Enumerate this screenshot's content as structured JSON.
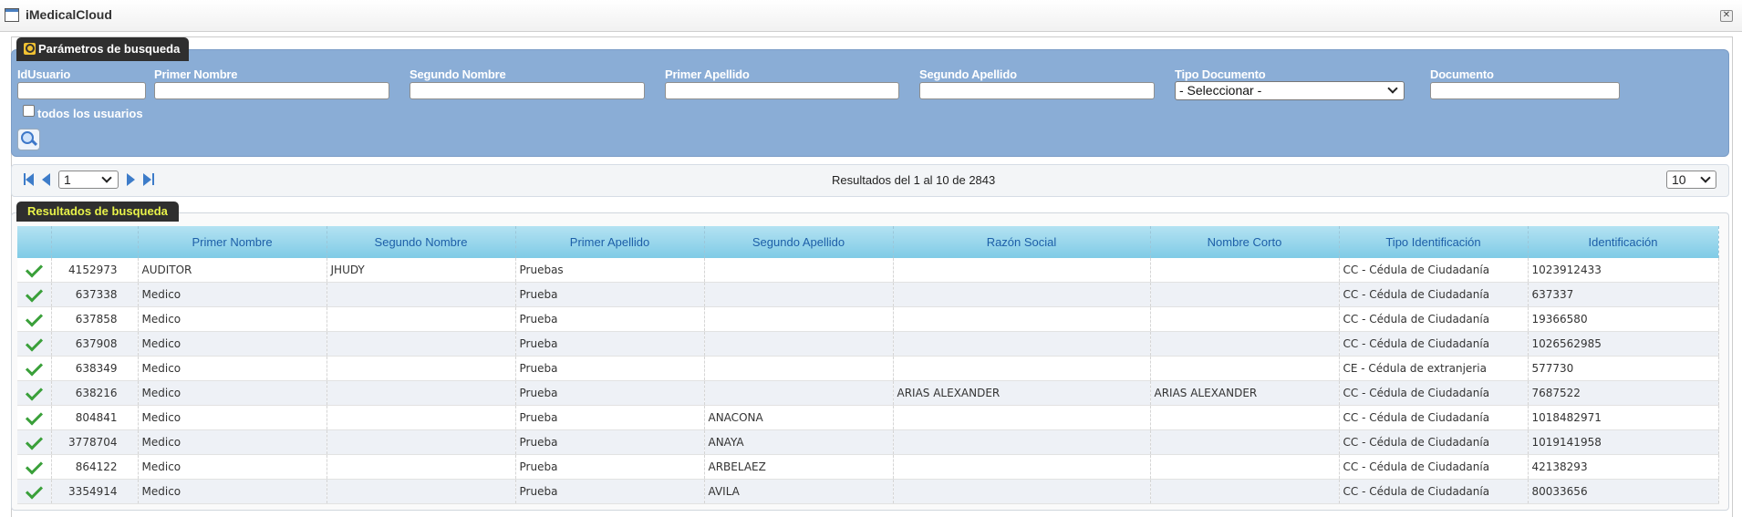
{
  "window": {
    "title": "iMedicalCloud",
    "close_label": "✕"
  },
  "search": {
    "tab_label": "Parámetros de busqueda",
    "fields": {
      "idusuario": {
        "label": "IdUsuario",
        "value": ""
      },
      "primer_nombre": {
        "label": "Primer Nombre",
        "value": ""
      },
      "segundo_nombre": {
        "label": "Segundo Nombre",
        "value": ""
      },
      "primer_apellido": {
        "label": "Primer Apellido",
        "value": ""
      },
      "segundo_apellido": {
        "label": "Segundo Apellido",
        "value": ""
      },
      "tipo_documento": {
        "label": "Tipo Documento",
        "selected": "- Seleccionar -"
      },
      "documento": {
        "label": "Documento",
        "value": ""
      }
    },
    "all_users_label": "todos los usuarios"
  },
  "pager": {
    "page": "1",
    "status": "Resultados del 1 al 10 de 2843",
    "page_size": "10"
  },
  "results": {
    "tab_label": "Resultados de busqueda",
    "columns": [
      "",
      "",
      "Primer Nombre",
      "Segundo Nombre",
      "Primer Apellido",
      "Segundo Apellido",
      "Razón Social",
      "Nombre Corto",
      "Tipo Identificación",
      "Identificación"
    ],
    "rows": [
      {
        "id": "4152973",
        "primer_nombre": "AUDITOR",
        "segundo_nombre": "JHUDY",
        "primer_apellido": "Pruebas",
        "segundo_apellido": "",
        "razon_social": "",
        "nombre_corto": "",
        "tipo_identificacion": "CC - Cédula de Ciudadanía",
        "identificacion": "1023912433"
      },
      {
        "id": "637338",
        "primer_nombre": "Medico",
        "segundo_nombre": "",
        "primer_apellido": "Prueba",
        "segundo_apellido": "",
        "razon_social": "",
        "nombre_corto": "",
        "tipo_identificacion": "CC - Cédula de Ciudadanía",
        "identificacion": "637337"
      },
      {
        "id": "637858",
        "primer_nombre": "Medico",
        "segundo_nombre": "",
        "primer_apellido": "Prueba",
        "segundo_apellido": "",
        "razon_social": "",
        "nombre_corto": "",
        "tipo_identificacion": "CC - Cédula de Ciudadanía",
        "identificacion": "19366580"
      },
      {
        "id": "637908",
        "primer_nombre": "Medico",
        "segundo_nombre": "",
        "primer_apellido": "Prueba",
        "segundo_apellido": "",
        "razon_social": "",
        "nombre_corto": "",
        "tipo_identificacion": "CC - Cédula de Ciudadanía",
        "identificacion": "1026562985"
      },
      {
        "id": "638349",
        "primer_nombre": "Medico",
        "segundo_nombre": "",
        "primer_apellido": "Prueba",
        "segundo_apellido": "",
        "razon_social": "",
        "nombre_corto": "",
        "tipo_identificacion": "CE - Cédula de extranjeria",
        "identificacion": "577730"
      },
      {
        "id": "638216",
        "primer_nombre": "Medico",
        "segundo_nombre": "",
        "primer_apellido": "Prueba",
        "segundo_apellido": "",
        "razon_social": "ARIAS ALEXANDER",
        "nombre_corto": "ARIAS ALEXANDER",
        "tipo_identificacion": "CC - Cédula de Ciudadanía",
        "identificacion": "7687522"
      },
      {
        "id": "804841",
        "primer_nombre": "Medico",
        "segundo_nombre": "",
        "primer_apellido": "Prueba",
        "segundo_apellido": "ANACONA",
        "razon_social": "",
        "nombre_corto": "",
        "tipo_identificacion": "CC - Cédula de Ciudadanía",
        "identificacion": "1018482971"
      },
      {
        "id": "3778704",
        "primer_nombre": "Medico",
        "segundo_nombre": "",
        "primer_apellido": "Prueba",
        "segundo_apellido": "ANAYA",
        "razon_social": "",
        "nombre_corto": "",
        "tipo_identificacion": "CC - Cédula de Ciudadanía",
        "identificacion": "1019141958"
      },
      {
        "id": "864122",
        "primer_nombre": "Medico",
        "segundo_nombre": "",
        "primer_apellido": "Prueba",
        "segundo_apellido": "ARBELAEZ",
        "razon_social": "",
        "nombre_corto": "",
        "tipo_identificacion": "CC - Cédula de Ciudadanía",
        "identificacion": "42138293"
      },
      {
        "id": "3354914",
        "primer_nombre": "Medico",
        "segundo_nombre": "",
        "primer_apellido": "Prueba",
        "segundo_apellido": "AVILA",
        "razon_social": "",
        "nombre_corto": "",
        "tipo_identificacion": "CC - Cédula de Ciudadanía",
        "identificacion": "80033656"
      }
    ]
  },
  "colors": {
    "panel_blue": "#8aadd6",
    "header_blue": "#7fcbe6",
    "header_text": "#1d5fa8",
    "results_tab_text": "#e8f24a",
    "check_green": "#3aa03a"
  }
}
